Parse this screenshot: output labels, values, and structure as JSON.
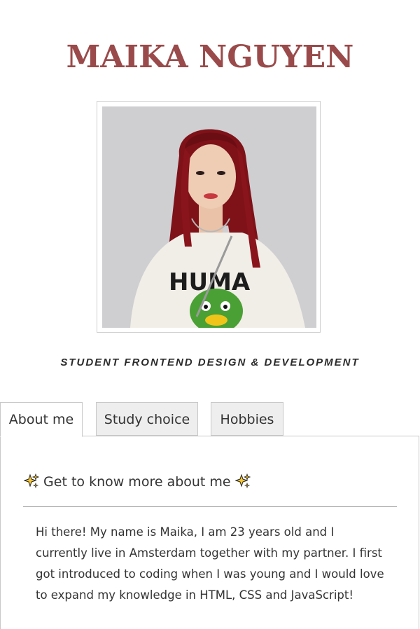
{
  "header": {
    "name": "MAIKA NGUYEN",
    "subtitle": "STUDENT FRONTEND DESIGN & DEVELOPMENT"
  },
  "profile_photo": {
    "alt": "Portrait of Maika Nguyen"
  },
  "tabs": [
    {
      "label": "About me",
      "active": true
    },
    {
      "label": "Study choice",
      "active": false
    },
    {
      "label": "Hobbies",
      "active": false
    }
  ],
  "about": {
    "heading": "Get to know more about me",
    "heading_icon": "sparkles-icon",
    "text": "Hi there! My name is Maika, I am 23 years old and I currently live in Amsterdam together with my partner. I first got introduced to coding when I was young and I would love to expand my knowledge in HTML, CSS and JavaScript!"
  },
  "colors": {
    "name_color": "#9a4a4a",
    "tab_inactive_bg": "#eeeeee",
    "border": "#c8c8c8"
  }
}
